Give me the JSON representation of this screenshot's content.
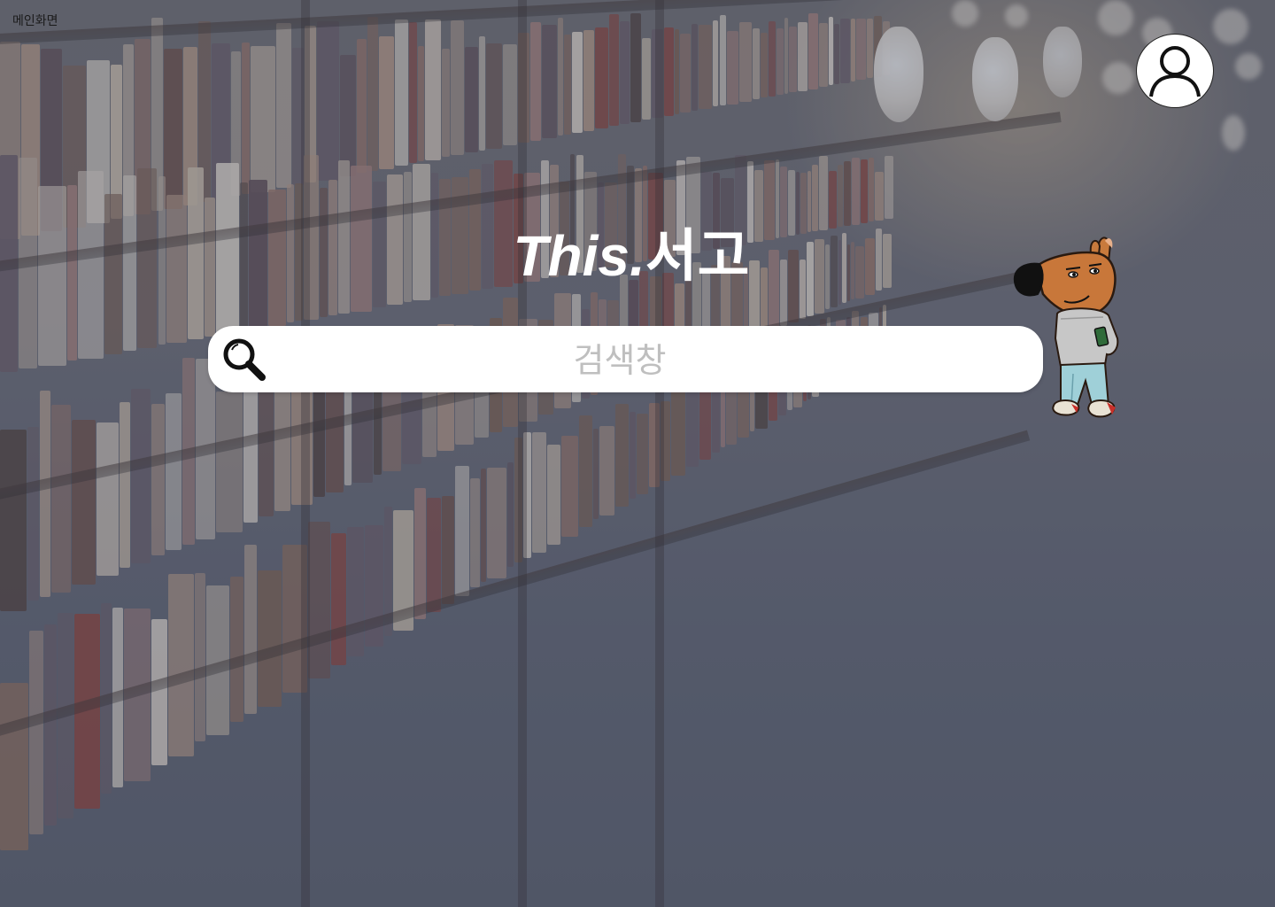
{
  "page": {
    "label": "메인화면"
  },
  "header": {
    "profile_icon": "user-icon"
  },
  "logo": {
    "text_en": "This.",
    "text_ko": "서고"
  },
  "search": {
    "placeholder": "검색창",
    "value": "",
    "icon": "magnifier-icon"
  },
  "mascot": {
    "icon": "dog-mascot-illustration"
  },
  "background": {
    "description_icon": "library-bookshelf-photo"
  },
  "colors": {
    "logo_text": "#ffffff",
    "search_bg": "#ffffff",
    "placeholder": "#bfbfbf",
    "overlay": "#5b5f6d"
  }
}
